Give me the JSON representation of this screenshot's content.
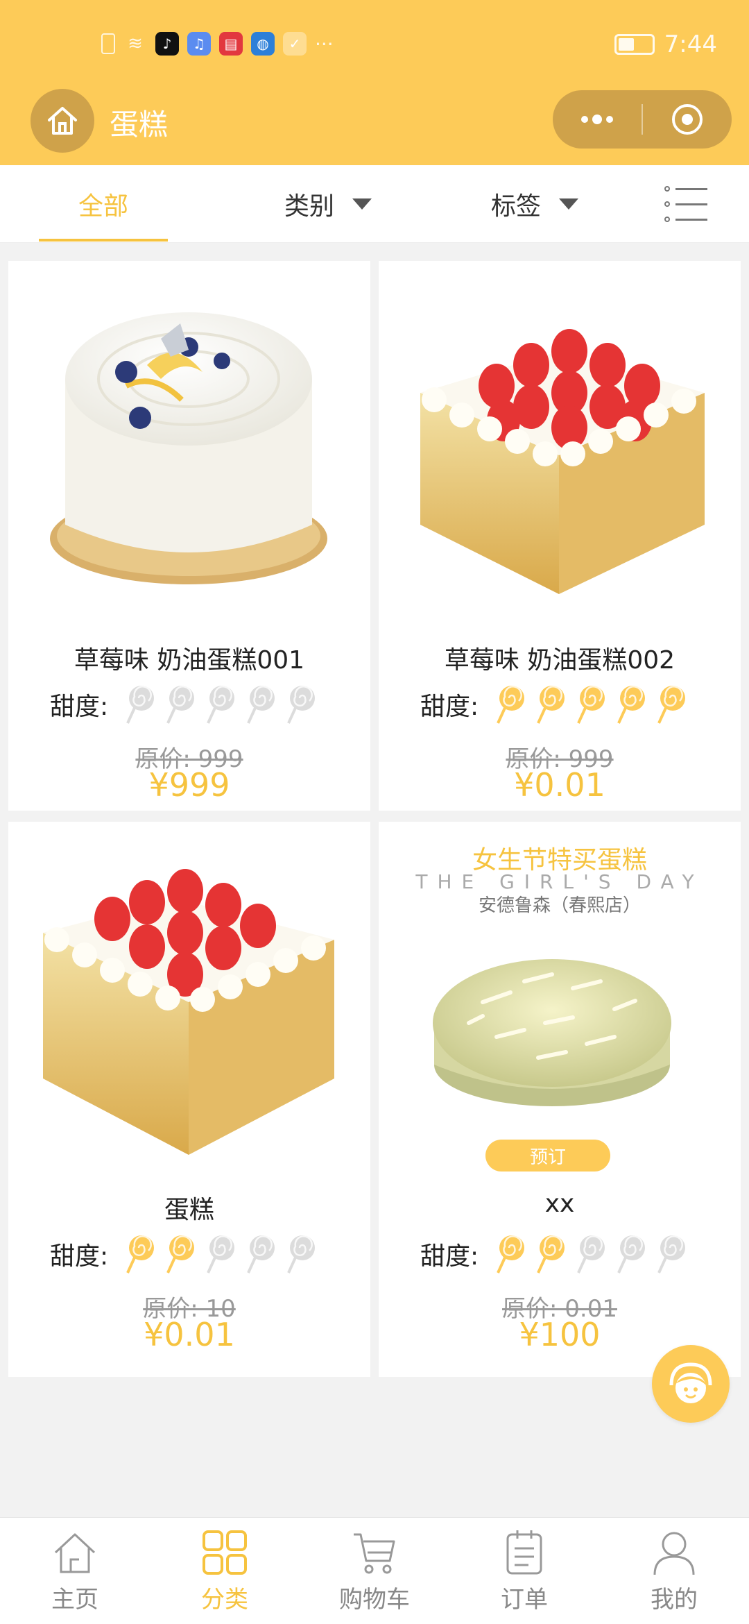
{
  "status_bar": {
    "time": "7:44",
    "overflow": "···"
  },
  "header": {
    "title": "蛋糕"
  },
  "filters": {
    "all_label": "全部",
    "category_label": "类别",
    "tag_label": "标签"
  },
  "products": [
    {
      "name": "草莓味 奶油蛋糕001",
      "sweetness_label": "甜度:",
      "sweetness": 0,
      "sweetness_max": 5,
      "original_price": "原价: 999",
      "price": "¥999",
      "image": "white-cream-cake-with-blueberries"
    },
    {
      "name": "草莓味 奶油蛋糕002",
      "sweetness_label": "甜度:",
      "sweetness": 5,
      "sweetness_max": 5,
      "original_price": "原价: 999",
      "price": "¥0.01",
      "image": "strawberry-square-cake"
    },
    {
      "name": "蛋糕",
      "sweetness_label": "甜度:",
      "sweetness": 2,
      "sweetness_max": 5,
      "original_price": "原价: 10",
      "price": "¥0.01",
      "image": "strawberry-square-cake"
    },
    {
      "name": "xx",
      "sweetness_label": "甜度:",
      "sweetness": 2,
      "sweetness_max": 5,
      "original_price": "原价: 0.01",
      "price": "¥100",
      "image": "white-chocolate-flake-cake",
      "banner_title": "女生节特买蛋糕",
      "banner_subtitle": "THE GIRL'S DAY",
      "banner_store": "安德鲁森（春熙店）",
      "preorder_label": "预订"
    }
  ],
  "tabbar": {
    "items": [
      {
        "label": "主页",
        "icon": "home-icon",
        "active": false
      },
      {
        "label": "分类",
        "icon": "category-grid-icon",
        "active": true
      },
      {
        "label": "购物车",
        "icon": "cart-icon",
        "active": false
      },
      {
        "label": "订单",
        "icon": "order-clipboard-icon",
        "active": false
      },
      {
        "label": "我的",
        "icon": "profile-icon",
        "active": false
      }
    ]
  },
  "colors": {
    "accent": "#fdcb58",
    "accent_text": "#f6c33f",
    "lollipop_on": "#fdcb58",
    "lollipop_off": "#dcdcdc"
  }
}
